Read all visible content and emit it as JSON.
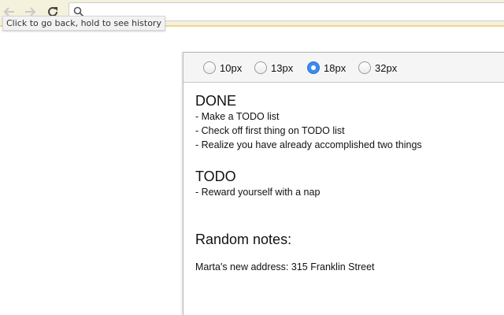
{
  "browser": {
    "tooltip": "Click to go back, hold to see history",
    "omnibox": {
      "value": "",
      "placeholder": ""
    }
  },
  "popup": {
    "font_sizes": [
      {
        "label": "10px",
        "selected": false
      },
      {
        "label": "13px",
        "selected": false
      },
      {
        "label": "18px",
        "selected": true
      },
      {
        "label": "32px",
        "selected": false
      }
    ],
    "accent_color": "#3b8bf0",
    "done": {
      "heading": "DONE",
      "items": [
        "- Make a TODO list",
        "- Check off first thing on TODO list",
        "- Realize you have already accomplished two things"
      ]
    },
    "todo": {
      "heading": "TODO",
      "items": [
        "- Reward yourself with a nap"
      ]
    },
    "notes": {
      "heading": "Random notes:",
      "text": "Marta's new address: 315 Franklin Street"
    }
  }
}
